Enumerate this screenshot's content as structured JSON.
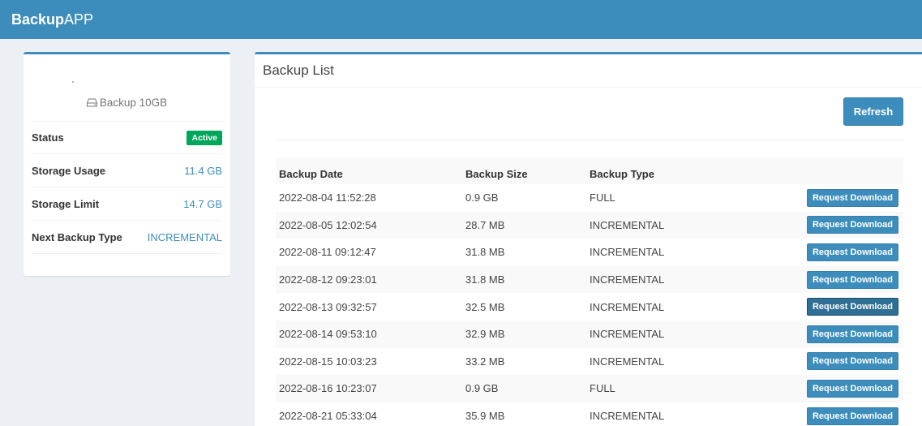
{
  "app": {
    "brand_bold": "Backup",
    "brand_light": "APP"
  },
  "package": {
    "icon": "hdd-icon",
    "name": "Backup 10GB"
  },
  "info": {
    "status_label": "Status",
    "status_value": "Active",
    "usage_label": "Storage Usage",
    "usage_value": "11.4 GB",
    "limit_label": "Storage Limit",
    "limit_value": "14.7 GB",
    "next_label": "Next Backup Type",
    "next_value": "INCREMENTAL"
  },
  "colors": {
    "accent": "#3c8dbc",
    "active": "#00a65a"
  },
  "backup_list": {
    "title": "Backup List",
    "refresh_label": "Refresh",
    "columns": [
      "Backup Date",
      "Backup Size",
      "Backup Type"
    ],
    "action_label": "Request Download",
    "rows": [
      {
        "date": "2022-08-04 11:52:28",
        "size": "0.9 GB",
        "type": "FULL"
      },
      {
        "date": "2022-08-05 12:02:54",
        "size": "28.7 MB",
        "type": "INCREMENTAL"
      },
      {
        "date": "2022-08-11 09:12:47",
        "size": "31.8 MB",
        "type": "INCREMENTAL"
      },
      {
        "date": "2022-08-12 09:23:01",
        "size": "31.8 MB",
        "type": "INCREMENTAL"
      },
      {
        "date": "2022-08-13 09:32:57",
        "size": "32.5 MB",
        "type": "INCREMENTAL"
      },
      {
        "date": "2022-08-14 09:53:10",
        "size": "32.9 MB",
        "type": "INCREMENTAL"
      },
      {
        "date": "2022-08-15 10:03:23",
        "size": "33.2 MB",
        "type": "INCREMENTAL"
      },
      {
        "date": "2022-08-16 10:23:07",
        "size": "0.9 GB",
        "type": "FULL"
      },
      {
        "date": "2022-08-21 05:33:04",
        "size": "35.9 MB",
        "type": "INCREMENTAL"
      }
    ]
  }
}
